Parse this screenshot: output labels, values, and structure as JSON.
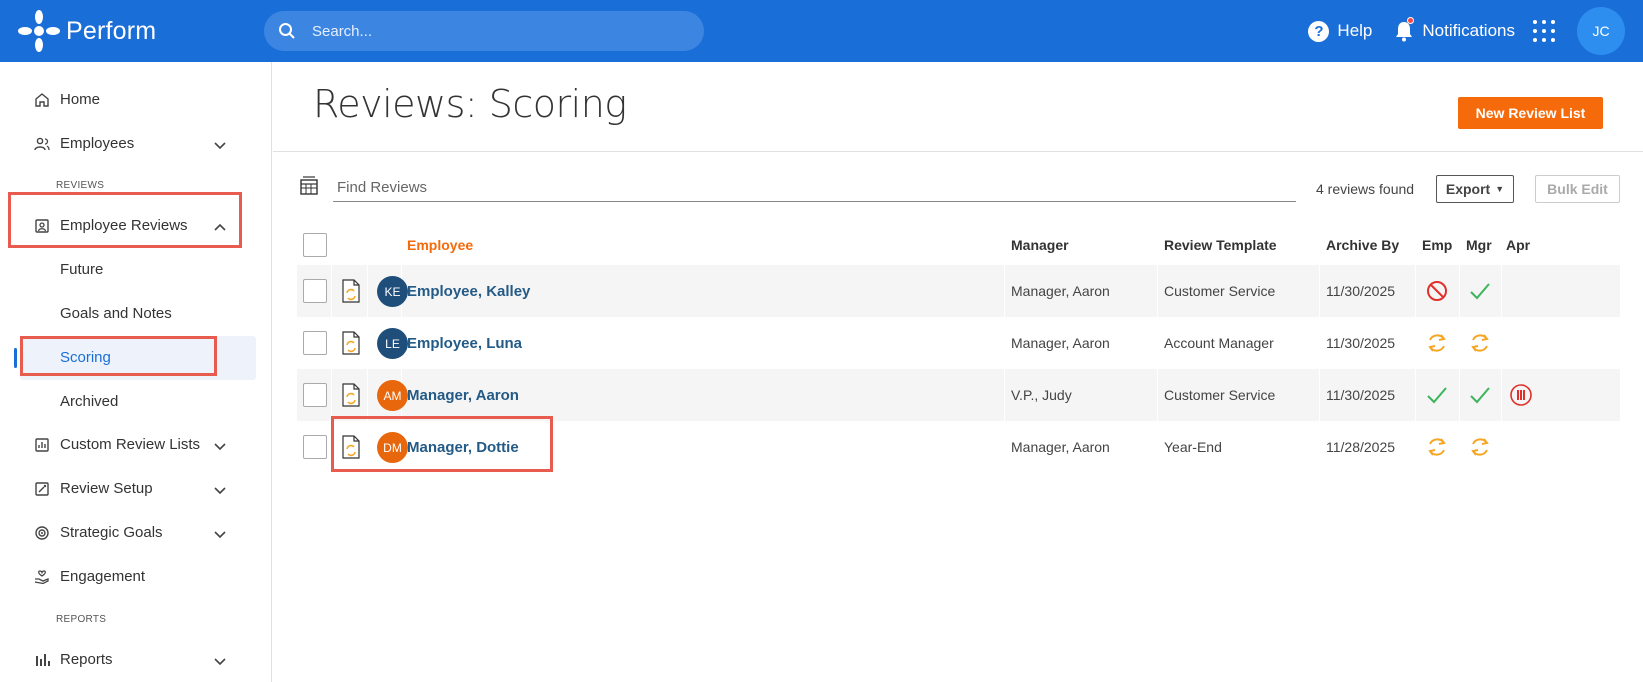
{
  "app": {
    "name": "Perform"
  },
  "search": {
    "placeholder": "Search..."
  },
  "topbar": {
    "help": "Help",
    "notifications": "Notifications",
    "user_initials": "JC"
  },
  "sidebar": {
    "home": "Home",
    "employees": "Employees",
    "section_reviews": "REVIEWS",
    "employee_reviews": "Employee Reviews",
    "future": "Future",
    "goals_and_notes": "Goals and Notes",
    "scoring": "Scoring",
    "archived": "Archived",
    "custom_review_lists": "Custom Review Lists",
    "review_setup": "Review Setup",
    "strategic_goals": "Strategic Goals",
    "engagement": "Engagement",
    "section_reports": "REPORTS",
    "reports": "Reports"
  },
  "page": {
    "title": "Reviews: Scoring",
    "new_review_list": "New Review List",
    "find_placeholder": "Find Reviews",
    "found": "4 reviews found",
    "export": "Export",
    "bulk_edit": "Bulk Edit"
  },
  "table": {
    "columns": {
      "employee": "Employee",
      "manager": "Manager",
      "template": "Review Template",
      "archive_by": "Archive By",
      "emp": "Emp",
      "mgr": "Mgr",
      "apr": "Apr"
    },
    "rows": [
      {
        "initials": "KE",
        "avatar_color": "#1e4e79",
        "employee": "Employee, Kalley",
        "manager": "Manager, Aaron",
        "template": "Customer Service",
        "archive_by": "11/30/2025",
        "emp": "blocked",
        "mgr": "complete",
        "apr": ""
      },
      {
        "initials": "LE",
        "avatar_color": "#1e4e79",
        "employee": "Employee, Luna",
        "manager": "Manager, Aaron",
        "template": "Account Manager",
        "archive_by": "11/30/2025",
        "emp": "in-progress",
        "mgr": "in-progress",
        "apr": ""
      },
      {
        "initials": "AM",
        "avatar_color": "#e8660c",
        "employee": "Manager, Aaron",
        "manager": "V.P., Judy",
        "template": "Customer Service",
        "archive_by": "11/30/2025",
        "emp": "complete",
        "mgr": "complete",
        "apr": "paused"
      },
      {
        "initials": "DM",
        "avatar_color": "#e8660c",
        "employee": "Manager, Dottie",
        "manager": "Manager, Aaron",
        "template": "Year-End",
        "archive_by": "11/28/2025",
        "emp": "in-progress",
        "mgr": "in-progress",
        "apr": ""
      }
    ]
  },
  "colors": {
    "brand_blue": "#1a6ed8",
    "accent_orange": "#f56a0b",
    "link": "#235a86",
    "highlight_box": "#e85c4f"
  }
}
